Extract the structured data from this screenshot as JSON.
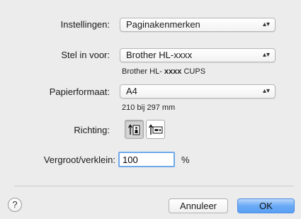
{
  "settings": {
    "label": "Instellingen:",
    "value": "Paginakenmerken",
    "arrows": "⌃⌄"
  },
  "format_for": {
    "label": "Stel in voor:",
    "value": "Brother HL-xxxx",
    "description_prefix": "Brother HL-",
    "description_model": "xxxx",
    "description_suffix": "CUPS"
  },
  "paper_size": {
    "label": "Papierformaat:",
    "value": "A4",
    "dimensions": "210 bij 297 mm"
  },
  "orientation": {
    "label": "Richting:",
    "selected": "portrait",
    "options": [
      "portrait",
      "landscape"
    ]
  },
  "scale": {
    "label": "Vergroot/verklein:",
    "value": "100",
    "unit": "%"
  },
  "footer": {
    "help": "?",
    "cancel": "Annuleer",
    "ok": "OK"
  }
}
